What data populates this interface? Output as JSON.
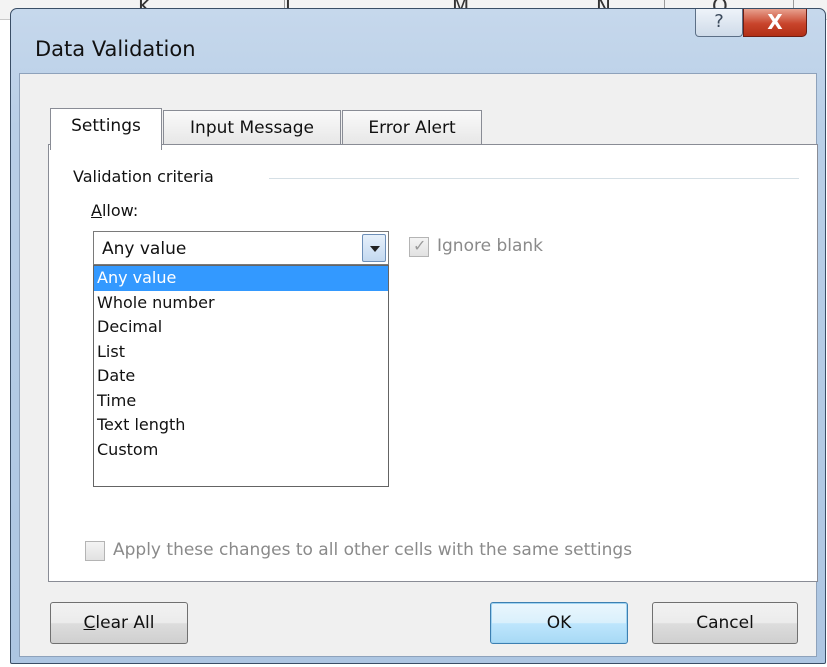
{
  "background_sheet": {
    "column_letters": [
      "K",
      "L",
      "M",
      "N",
      "O"
    ]
  },
  "window": {
    "title": "Data Validation",
    "help_glyph": "?",
    "close_glyph": "X"
  },
  "tabs": [
    {
      "label": "Settings",
      "active": true
    },
    {
      "label": "Input Message",
      "active": false
    },
    {
      "label": "Error Alert",
      "active": false
    }
  ],
  "settings": {
    "group_label": "Validation criteria",
    "allow_label_mnemonic": "A",
    "allow_label_rest": "llow:",
    "allow_value": "Any value",
    "allow_options": [
      "Any value",
      "Whole number",
      "Decimal",
      "List",
      "Date",
      "Time",
      "Text length",
      "Custom"
    ],
    "allow_selected_index": 0,
    "ignore_blank_label": "Ignore blank",
    "ignore_blank_checked": true,
    "apply_all_label": "Apply these changes to all other cells with the same settings",
    "apply_all_checked": false
  },
  "buttons": {
    "clear_all_mnemonic": "C",
    "clear_all_rest": "lear All",
    "ok": "OK",
    "cancel": "Cancel"
  },
  "colors": {
    "selection": "#3399ff",
    "titlebar": "#b9cfe7",
    "close_button": "#c8442b"
  }
}
